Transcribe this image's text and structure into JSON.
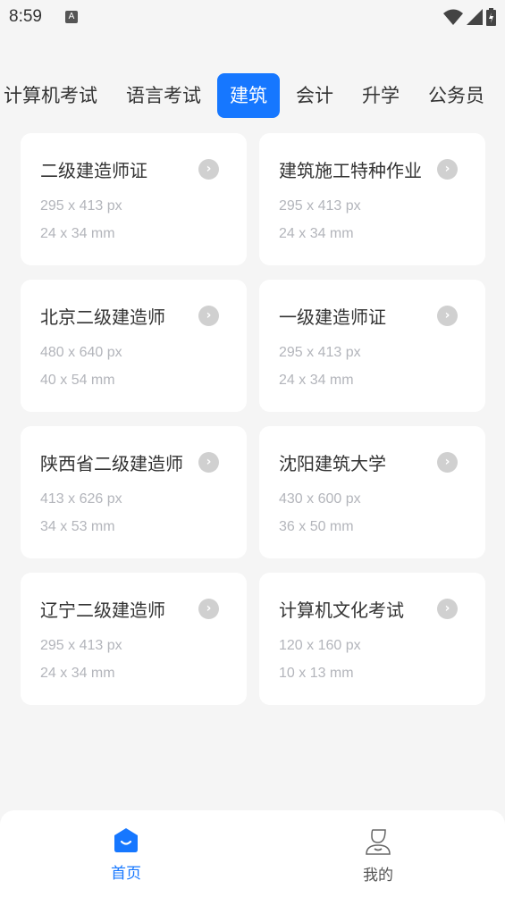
{
  "status": {
    "time": "8:59",
    "notification_icon": "A"
  },
  "tabs": [
    {
      "label": "计算机考试"
    },
    {
      "label": "语言考试"
    },
    {
      "label": "建筑",
      "active": true
    },
    {
      "label": "会计"
    },
    {
      "label": "升学"
    },
    {
      "label": "公务员"
    }
  ],
  "cards": [
    {
      "title": "二级建造师证",
      "px": "295 x 413 px",
      "mm": "24 x 34 mm"
    },
    {
      "title": "建筑施工特种作业",
      "px": "295 x 413 px",
      "mm": "24 x 34 mm"
    },
    {
      "title": "北京二级建造师",
      "px": "480 x 640 px",
      "mm": "40 x 54 mm"
    },
    {
      "title": "一级建造师证",
      "px": "295 x 413 px",
      "mm": "24 x 34 mm"
    },
    {
      "title": "陕西省二级建造师",
      "px": "413 x 626 px",
      "mm": "34 x 53 mm"
    },
    {
      "title": "沈阳建筑大学",
      "px": "430 x 600 px",
      "mm": "36 x 50 mm"
    },
    {
      "title": "辽宁二级建造师",
      "px": "295 x 413 px",
      "mm": "24 x 34 mm"
    },
    {
      "title": "计算机文化考试",
      "px": "120 x 160 px",
      "mm": "10 x 13 mm"
    }
  ],
  "nav": {
    "home": "首页",
    "mine": "我的",
    "accent": "#1677ff"
  }
}
